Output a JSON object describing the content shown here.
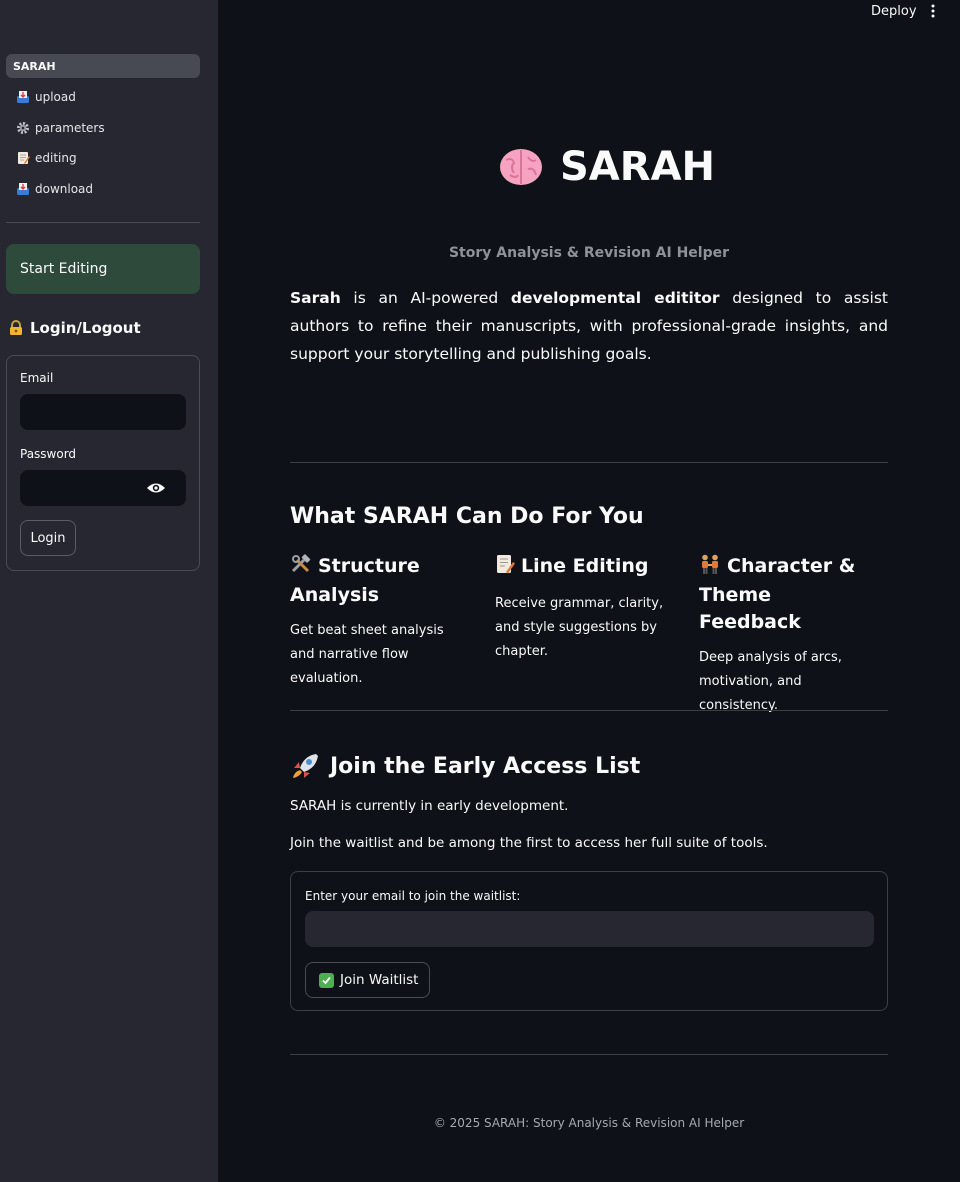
{
  "topbar": {
    "deploy_label": "Deploy",
    "menu_icon": "kebab-menu-icon"
  },
  "sidebar": {
    "nav": [
      {
        "label": "SARAH",
        "icon": ""
      },
      {
        "label": "upload",
        "icon": "inbox-tray-icon"
      },
      {
        "label": "parameters",
        "icon": "gear-icon"
      },
      {
        "label": "editing",
        "icon": "memo-icon"
      },
      {
        "label": "download",
        "icon": "inbox-tray-icon"
      }
    ],
    "start_button": "Start Editing",
    "login": {
      "title": "Login/Logout",
      "title_icon": "lock-key-icon",
      "email_label": "Email",
      "password_label": "Password",
      "login_button": "Login"
    }
  },
  "main": {
    "title": "SARAH",
    "title_icon": "brain-icon",
    "subtitle": "Story Analysis & Revision AI Helper",
    "intro": {
      "name": "Sarah",
      "part1": " is an AI-powered ",
      "bold": "developmental edititor",
      "part2": " designed to assist authors to refine their manuscripts, with professional-grade insights, and support your storytelling and publishing goals."
    },
    "features_heading": "What SARAH Can Do For You",
    "features": [
      {
        "icon": "hammer-wrench-icon",
        "title": "Structure Analysis",
        "text": "Get beat sheet analysis and narrative flow evaluation."
      },
      {
        "icon": "memo-icon",
        "title": "Line Editing",
        "text": "Receive grammar, clarity, and style suggestions by chapter."
      },
      {
        "icon": "people-holding-hands-icon",
        "title": "Character & Theme Feedback",
        "text": "Deep analysis of arcs, motivation, and consistency."
      }
    ],
    "early_access": {
      "heading": "Join the Early Access List",
      "icon": "rocket-icon",
      "line1": "SARAH is currently in early development.",
      "line2": "Join the waitlist and be among the first to access her full suite of tools.",
      "email_label": "Enter your email to join the waitlist:",
      "button": "Join Waitlist",
      "button_icon": "check-mark-icon"
    },
    "footer": "© 2025 SARAH: Story Analysis & Revision AI Helper"
  }
}
